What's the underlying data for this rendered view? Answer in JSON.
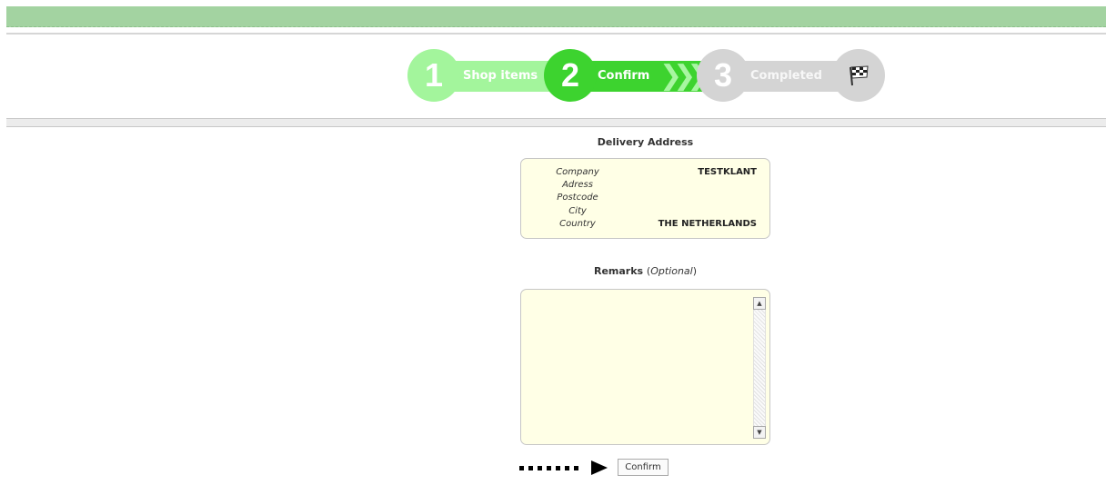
{
  "steps": [
    {
      "number": "1",
      "label": "Shop items"
    },
    {
      "number": "2",
      "label": "Confirm"
    },
    {
      "number": "3",
      "label": "Completed"
    }
  ],
  "step_icon": "checkered-flag-icon",
  "colors": {
    "done": "#a3f59c",
    "active": "#3dd32f",
    "pending": "#d4d4d4",
    "panel": "#ffffe6",
    "header": "#a3d3a1"
  },
  "delivery": {
    "title": "Delivery Address",
    "rows": [
      {
        "label": "Company",
        "value": "TESTKLANT"
      },
      {
        "label": "Adress",
        "value": ""
      },
      {
        "label": "Postcode",
        "value": ""
      },
      {
        "label": "City",
        "value": ""
      },
      {
        "label": "Country",
        "value": "THE NETHERLANDS"
      }
    ]
  },
  "remarks": {
    "title": "Remarks",
    "open": "(",
    "optional": "Optional",
    "close": ")",
    "value": ""
  },
  "confirm_button": "Confirm"
}
